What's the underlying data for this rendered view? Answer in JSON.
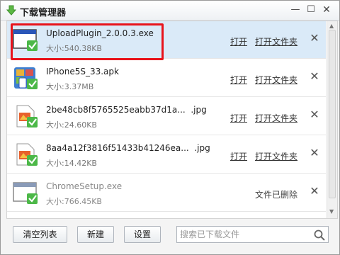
{
  "window": {
    "title": "下载管理器",
    "minimize_glyph": "—",
    "maximize_glyph": "☐",
    "close_glyph": "✕"
  },
  "downloads": [
    {
      "name": "UploadPlugin_2.0.0.3.exe",
      "size": "大小:540.38KB",
      "icon": "exe-window-icon",
      "open": "打开",
      "open_folder": "打开文件夹",
      "selected": true
    },
    {
      "name": "IPhone5S_33.apk",
      "size": "大小:3.37MB",
      "icon": "apk-app-icon",
      "open": "打开",
      "open_folder": "打开文件夹"
    },
    {
      "name": "2be48cb8f5765525eabb37d1a...  .jpg",
      "size": "大小:24.60KB",
      "icon": "jpg-image-icon",
      "open": "打开",
      "open_folder": "打开文件夹"
    },
    {
      "name": "8aa4a12f3816f51433b41246ea...  .jpg",
      "size": "大小:14.42KB",
      "icon": "jpg-image-icon",
      "open": "打开",
      "open_folder": "打开文件夹"
    },
    {
      "name": "ChromeSetup.exe",
      "size": "大小:766.45KB",
      "icon": "exe-window-icon",
      "status": "文件已删除"
    }
  ],
  "row_delete_glyph": "✕",
  "footer": {
    "clear_list": "清空列表",
    "new": "新建",
    "settings": "设置",
    "search_placeholder": "搜索已下载文件"
  },
  "colors": {
    "selected_row": "#daeaf8",
    "highlight_border": "#e8131b",
    "check_green": "#4cb848"
  }
}
